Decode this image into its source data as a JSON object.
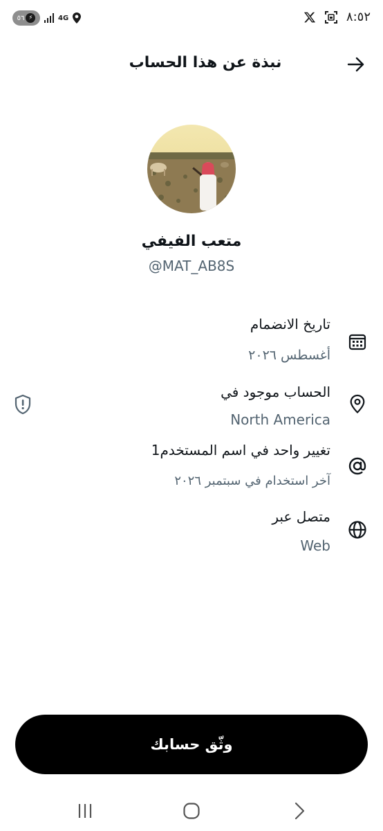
{
  "status_bar": {
    "time": "٨:٥٢",
    "battery": "٥٦",
    "network": "4G",
    "icons": [
      "x-app-icon",
      "screenshot-icon",
      "location-icon",
      "signal-icon",
      "battery-icon"
    ]
  },
  "header": {
    "title": "نبذة عن هذا الحساب",
    "back_icon": "arrow-right-icon"
  },
  "profile": {
    "display_name": "متعب الفيفي",
    "handle": "@MAT_AB8S"
  },
  "info": [
    {
      "icon": "calendar-icon",
      "title": "تاريخ الانضمام",
      "value": "أغسطس ٢٠٢٦"
    },
    {
      "icon": "location-pin-icon",
      "title": "الحساب موجود في",
      "value": "North America"
    },
    {
      "icon": "at-sign-icon",
      "title": "تغيير واحد في اسم المستخدم1",
      "value": "آخر استخدام في سبتمبر ٢٠٢٦"
    },
    {
      "icon": "globe-icon",
      "title": "متصل عبر",
      "value": "Web"
    }
  ],
  "verify_button": {
    "label": "وثّق حسابك"
  },
  "nav_bar": {
    "icons": [
      "recent-apps-icon",
      "home-icon",
      "back-chevron-icon"
    ]
  },
  "colors": {
    "primary_text": "#0f1419",
    "secondary_text": "#536471",
    "button_bg": "#000000"
  }
}
